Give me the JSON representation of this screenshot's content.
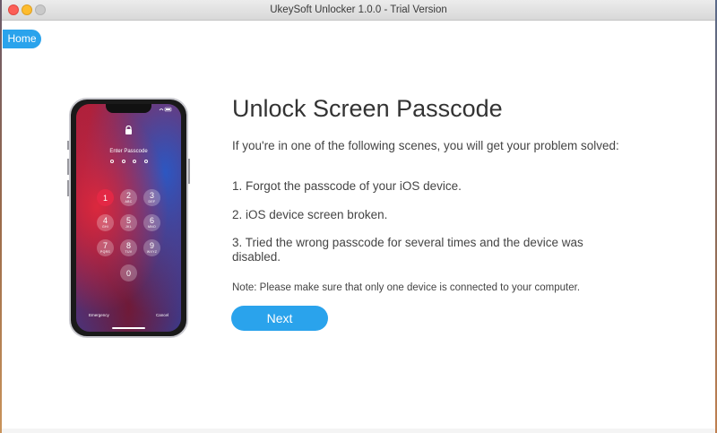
{
  "window": {
    "title": "UkeySoft Unlocker 1.0.0 - Trial Version"
  },
  "nav": {
    "home_label": "Home"
  },
  "phone": {
    "prompt": "Enter Passcode",
    "keys": [
      {
        "num": "1",
        "letters": ""
      },
      {
        "num": "2",
        "letters": "ABC"
      },
      {
        "num": "3",
        "letters": "DEF"
      },
      {
        "num": "4",
        "letters": "GHI"
      },
      {
        "num": "5",
        "letters": "JKL"
      },
      {
        "num": "6",
        "letters": "MNO"
      },
      {
        "num": "7",
        "letters": "PQRS"
      },
      {
        "num": "8",
        "letters": "TUV"
      },
      {
        "num": "9",
        "letters": "WXYZ"
      },
      {
        "num": "0",
        "letters": ""
      }
    ],
    "emergency": "Emergency",
    "cancel": "Cancel"
  },
  "main": {
    "headline": "Unlock Screen Passcode",
    "intro": "If you're in one of the following scenes, you will get your problem solved:",
    "items": [
      "1. Forgot the passcode of your iOS device.",
      "2. iOS device screen broken.",
      "3. Tried the wrong passcode for several times and the device was disabled."
    ],
    "note": "Note: Please make sure that only one device is connected to your computer.",
    "next_label": "Next"
  },
  "colors": {
    "accent": "#2aa3ec"
  }
}
